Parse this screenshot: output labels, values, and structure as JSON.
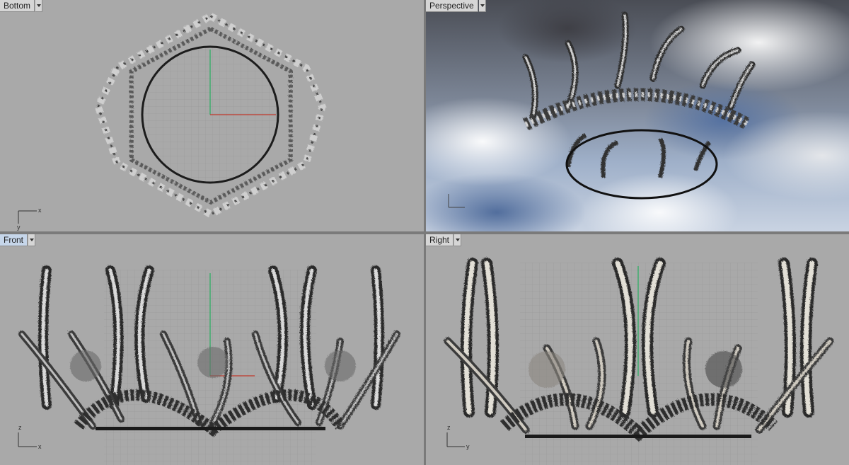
{
  "viewports": [
    {
      "id": "bottom",
      "label": "Bottom",
      "axis_h": "x",
      "axis_v": "y",
      "active": false
    },
    {
      "id": "perspective",
      "label": "Perspective",
      "axis_h": "x",
      "axis_v": "z",
      "active": false
    },
    {
      "id": "front",
      "label": "Front",
      "axis_h": "x",
      "axis_v": "z",
      "active": true
    },
    {
      "id": "right",
      "label": "Right",
      "axis_h": "y",
      "axis_v": "z",
      "active": false
    }
  ],
  "colors": {
    "viewport_bg": "#a9a9a9",
    "grid_line": "#9a9a9a",
    "grid_major": "#8a8a8a",
    "x_axis": "#c0392b",
    "y_axis": "#27ae60",
    "crown_dark": "#3a3a3a",
    "crown_mid": "#8d8d8d",
    "crown_light": "#e6e4de",
    "active_label": "#c6d6ea"
  }
}
